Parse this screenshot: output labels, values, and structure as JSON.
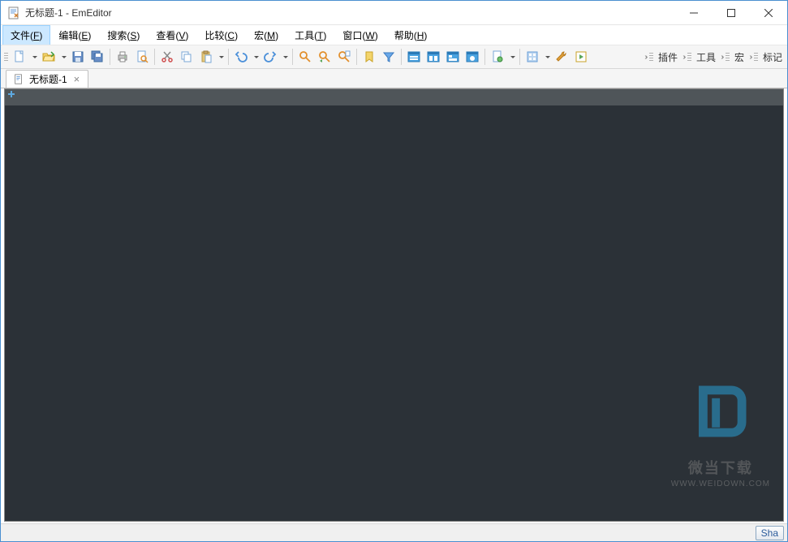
{
  "window": {
    "title": "无标题-1 - EmEditor"
  },
  "menu": {
    "items": [
      {
        "label_pre": "文件(",
        "key": "F",
        "label_post": ")",
        "active": true
      },
      {
        "label_pre": "编辑(",
        "key": "E",
        "label_post": ")"
      },
      {
        "label_pre": "搜索(",
        "key": "S",
        "label_post": ")"
      },
      {
        "label_pre": "查看(",
        "key": "V",
        "label_post": ")"
      },
      {
        "label_pre": "比较(",
        "key": "C",
        "label_post": ")"
      },
      {
        "label_pre": "宏(",
        "key": "M",
        "label_post": ")"
      },
      {
        "label_pre": "工具(",
        "key": "T",
        "label_post": ")"
      },
      {
        "label_pre": "窗口(",
        "key": "W",
        "label_post": ")"
      },
      {
        "label_pre": "帮助(",
        "key": "H",
        "label_post": ")"
      }
    ]
  },
  "toolbar_labels": {
    "plugins": "插件",
    "tools": "工具",
    "macros": "宏",
    "markers": "标记"
  },
  "tabs": {
    "items": [
      {
        "label": "无标题-1"
      }
    ]
  },
  "status": {
    "share": "Sha"
  },
  "watermark": {
    "line1": "微当下载",
    "line2": "WWW.WEIDOWN.COM"
  },
  "icons": {
    "new-file": "new-file-icon",
    "open-file": "open-file-icon",
    "save": "save-icon",
    "save-all": "save-all-icon",
    "print": "print-icon",
    "print-preview": "print-preview-icon",
    "cut": "cut-icon",
    "copy": "copy-icon",
    "paste": "paste-icon",
    "undo": "undo-icon",
    "redo": "redo-icon",
    "find": "find-icon",
    "find-next": "find-next-icon",
    "find-in-files": "find-in-files-icon",
    "bookmark": "bookmark-icon",
    "filter": "filter-icon",
    "layout1": "layout-icon",
    "layout2": "layout-icon",
    "layout3": "layout-icon",
    "layout4": "layout-icon",
    "doc": "document-icon",
    "gear": "gear-icon",
    "tool": "tool-icon",
    "play": "play-icon"
  }
}
